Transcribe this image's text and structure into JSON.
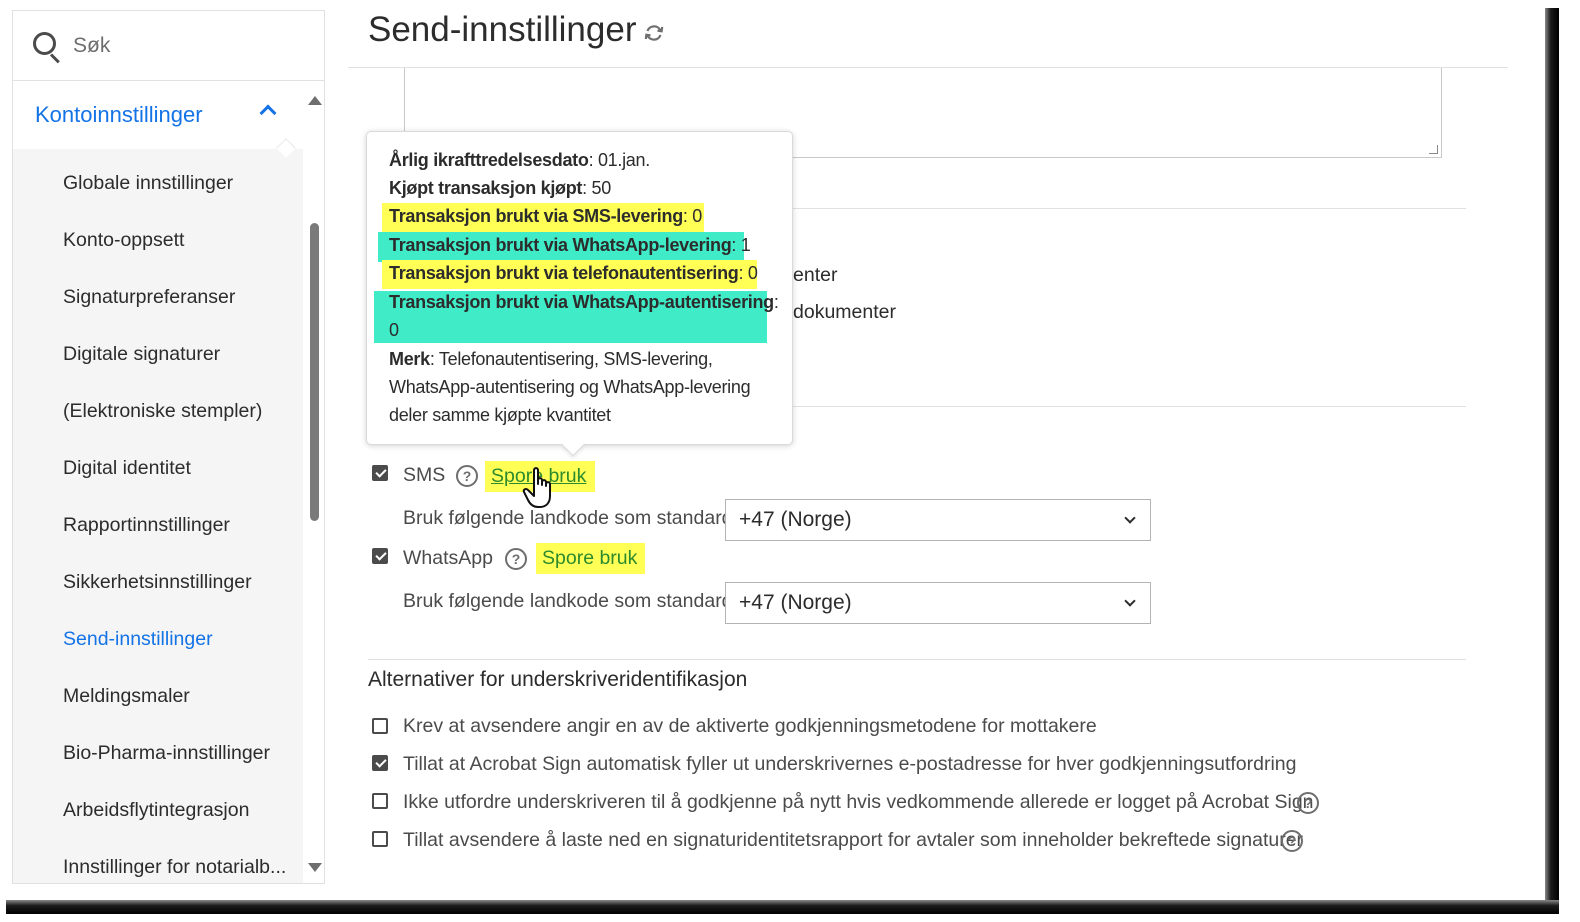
{
  "sidebar": {
    "search_placeholder": "Søk",
    "section_title": "Kontoinnstillinger",
    "items": [
      {
        "label": "Globale innstillinger"
      },
      {
        "label": "Konto-oppsett"
      },
      {
        "label": "Signaturpreferanser"
      },
      {
        "label": "Digitale signaturer"
      },
      {
        "label": "(Elektroniske stempler)"
      },
      {
        "label": "Digital identitet"
      },
      {
        "label": "Rapportinnstillinger"
      },
      {
        "label": "Sikkerhetsinnstillinger"
      },
      {
        "label": "Send-innstillinger"
      },
      {
        "label": "Meldingsmaler"
      },
      {
        "label": "Bio-Pharma-innstillinger"
      },
      {
        "label": "Arbeidsflytintegrasjon"
      },
      {
        "label": "Innstillinger for notarialb..."
      }
    ],
    "active_item": "Send-innstillinger"
  },
  "main": {
    "title": "Send-innstillinger",
    "behind_text_1": "enter",
    "behind_text_2": "dokumenter"
  },
  "tooltip": {
    "lines": [
      {
        "label": "Årlig ikrafttredelsesdato",
        "value": ": 01.jan."
      },
      {
        "label": "Kjøpt transaksjon kjøpt",
        "value": ": 50"
      },
      {
        "label": "Transaksjon brukt via SMS-levering",
        "value": ": 0"
      },
      {
        "label": "Transaksjon brukt via WhatsApp-levering",
        "value": ": 1"
      },
      {
        "label": "Transaksjon brukt via telefonautentisering",
        "value": ": 0"
      },
      {
        "label": "Transaksjon brukt via WhatsApp-autentisering",
        "value": ":"
      },
      {
        "label": "",
        "value": "0"
      }
    ],
    "note_label": "Merk",
    "note_lines": [
      ": Telefonautentisering, SMS-levering,",
      "WhatsApp-autentisering og WhatsApp-levering",
      "deler samme kjøpte kvantitet"
    ]
  },
  "delivery": {
    "sms": {
      "label": "SMS",
      "checked": true,
      "track_label": "Spore bruk",
      "country_label": "Bruk følgende landkode som standard:",
      "country_value": "+47 (Norge)"
    },
    "whatsapp": {
      "label": "WhatsApp",
      "checked": true,
      "track_label": "Spore bruk",
      "country_label": "Bruk følgende landkode som standard:",
      "country_value": "+47 (Norge)"
    }
  },
  "signer_id": {
    "heading": "Alternativer for underskriveridentifikasjon",
    "options": [
      {
        "label": "Krev at avsendere angir en av de aktiverte godkjenningsmetodene for mottakere",
        "checked": false
      },
      {
        "label": "Tillat at Acrobat Sign automatisk fyller ut underskrivernes e-postadresse for hver godkjenningsutfordring",
        "checked": true
      },
      {
        "label": "Ikke utfordre underskriveren til å godkjenne på nytt hvis vedkommende allerede er logget på Acrobat Sign",
        "checked": false
      },
      {
        "label": "Tillat avsendere å laste ned en signaturidentitetsrapport for avtaler som inneholder bekreftede signaturer",
        "checked": false
      }
    ]
  },
  "help_glyph": "?",
  "colors": {
    "accent": "#1473e6",
    "highlight_yellow": "#ffff56",
    "highlight_green": "#40ecc8",
    "link_green": "#2d8b2d"
  }
}
